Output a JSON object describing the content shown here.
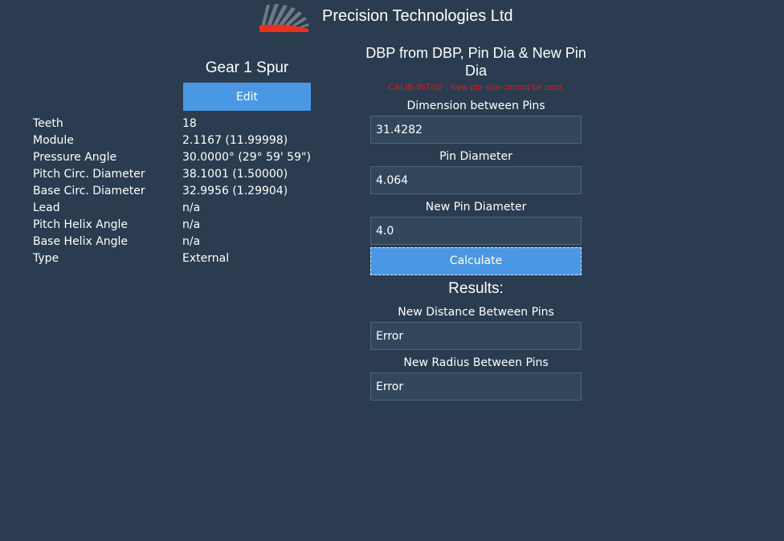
{
  "header": {
    "logo_icon": "company-logo-fan-icon",
    "title": "Precision Technologies Ltd"
  },
  "gear": {
    "title": "Gear 1 Spur",
    "edit_label": "Edit",
    "properties": [
      {
        "label": "Teeth",
        "value": "18"
      },
      {
        "label": "Module",
        "value": "2.1167  (11.99998)"
      },
      {
        "label": "Pressure Angle",
        "value": "30.0000° (29° 59' 59\")"
      },
      {
        "label": "Pitch Circ. Diameter",
        "value": "38.1001  (1.50000)"
      },
      {
        "label": "Base Circ. Diameter",
        "value": "32.9956  (1.29904)"
      },
      {
        "label": "Lead",
        "value": "n/a"
      },
      {
        "label": "Pitch Helix Angle",
        "value": "n/a"
      },
      {
        "label": "Base Helix Angle",
        "value": "n/a"
      },
      {
        "label": "Type",
        "value": "External"
      }
    ]
  },
  "calculator": {
    "title": "DBP from DBP, Pin Dia & New Pin Dia",
    "error": "CALIB-INT-02 : New pin size cannot be zero.",
    "dbp_label": "Dimension between Pins",
    "dbp_value": "31.4282",
    "pin_label": "Pin Diameter",
    "pin_value": "4.064",
    "new_pin_label": "New Pin Diameter",
    "new_pin_value": "4.0",
    "calculate_label": "Calculate",
    "results_title": "Results:",
    "new_distance_label": "New Distance Between Pins",
    "new_distance_value": "Error",
    "new_radius_label": "New Radius Between Pins",
    "new_radius_value": "Error"
  },
  "colors": {
    "background": "#2b3c50",
    "accent": "#4a98e4",
    "error": "#e01818",
    "logo_red": "#e8321e",
    "logo_grey": "#6f7a86"
  }
}
